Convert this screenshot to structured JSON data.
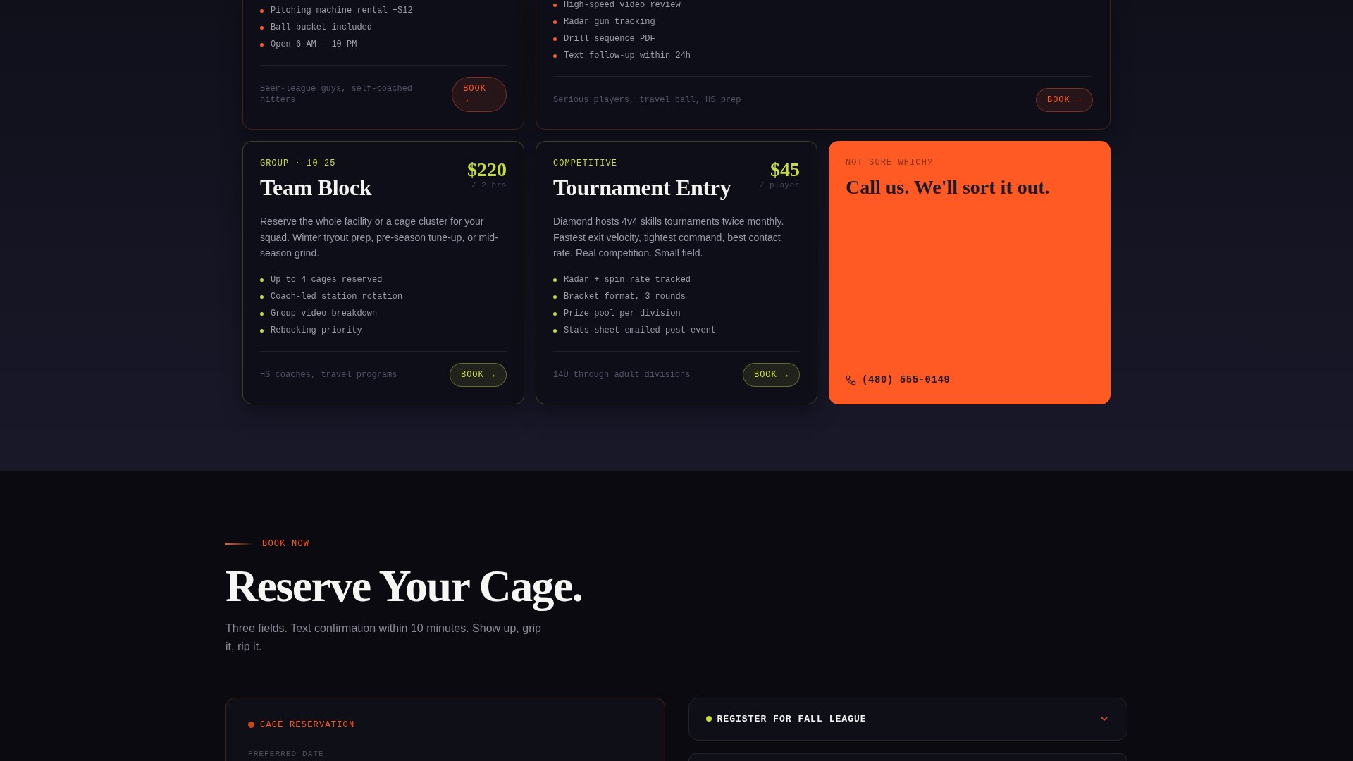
{
  "plans_top": [
    {
      "color": "#ff5a24",
      "features": [
        "Pitching machine rental +$12",
        "Ball bucket included",
        "Open 6 AM – 10 PM"
      ],
      "audience": "Beer-league guys, self-coached hitters",
      "button": "BOOK →"
    },
    {
      "color": "#ff5a24",
      "features": [
        "High-speed video review",
        "Radar gun tracking",
        "Drill sequence PDF",
        "Text follow-up within 24h"
      ],
      "audience": "Serious players, travel ball, HS prep",
      "button": "BOOK →"
    }
  ],
  "plans": [
    {
      "color": "#c8dc3c",
      "category": "GROUP · 10–25",
      "title": "Team Block",
      "price": "$220",
      "unit": "/ 2 hrs",
      "description": "Reserve the whole facility or a cage cluster for your squad. Winter tryout prep, pre-season tune-up, or mid-season grind.",
      "features": [
        "Up to 4 cages reserved",
        "Coach-led station rotation",
        "Group video breakdown",
        "Rebooking priority"
      ],
      "audience": "HS coaches, travel programs",
      "button": "BOOK →"
    },
    {
      "color": "#c8dc3c",
      "category": "COMPETITIVE",
      "title": "Tournament Entry",
      "price": "$45",
      "unit": "/ player",
      "description": "Diamond hosts 4v4 skills tournaments twice monthly. Fastest exit velocity, tightest command, best contact rate. Real competition. Small field.",
      "features": [
        "Radar + spin rate tracked",
        "Bracket format, 3 rounds",
        "Prize pool per division",
        "Stats sheet emailed post-event"
      ],
      "audience": "14U through adult divisions",
      "button": "BOOK →"
    }
  ],
  "callout": {
    "label": "NOT SURE WHICH?",
    "title": "Call us. We'll sort it out.",
    "phone": "(480) 555-0149"
  },
  "booking": {
    "label": "BOOK NOW",
    "title": "Reserve Your Cage.",
    "subtitle": "Three fields. Text confirmation within 10 minutes. Show up, grip it, rip it.",
    "form": {
      "title": "CAGE RESERVATION",
      "field_label": "PREFERRED DATE"
    },
    "accordion": [
      {
        "label": "REGISTER FOR FALL LEAGUE",
        "color": "#c8dc3c",
        "expanded": false
      }
    ]
  }
}
